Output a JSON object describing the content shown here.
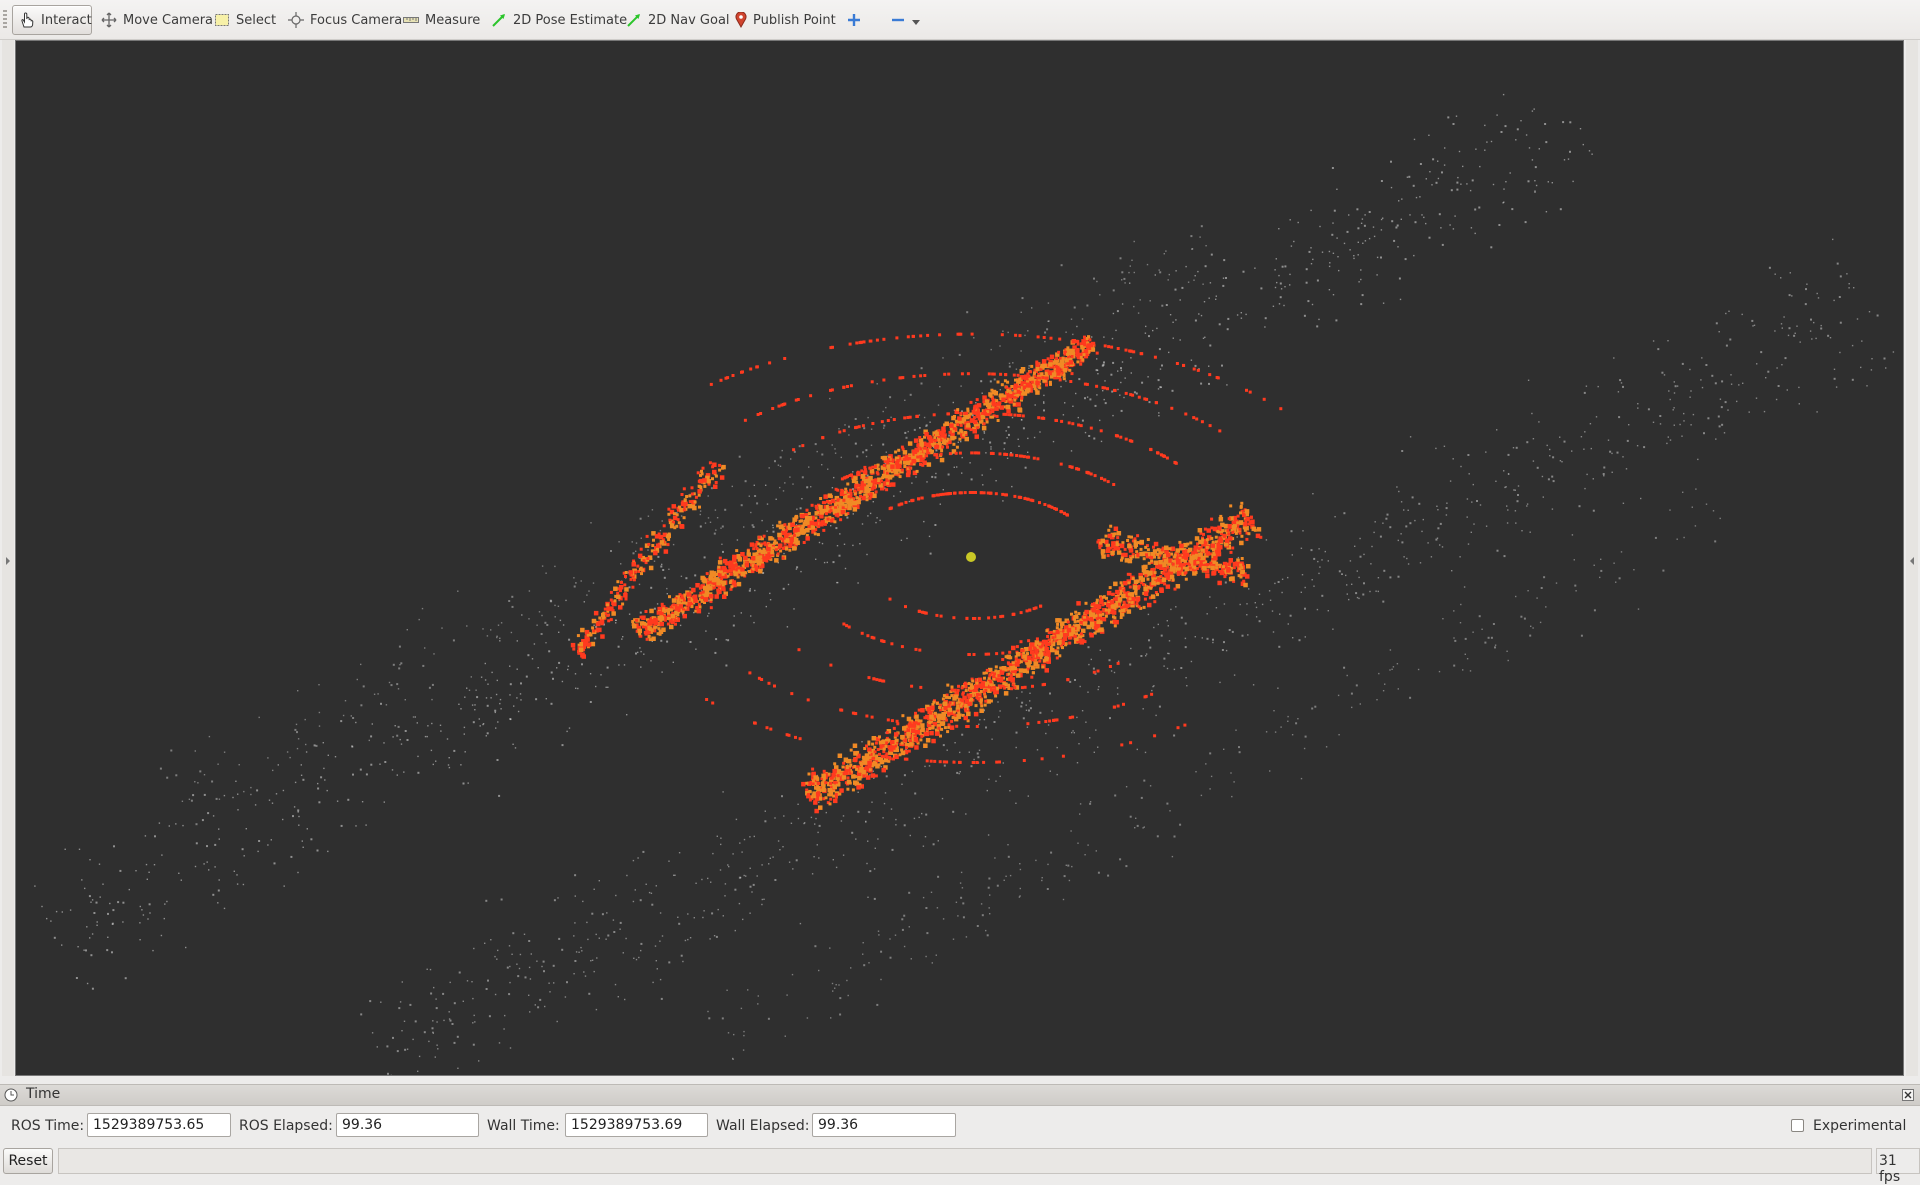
{
  "toolbar": {
    "tools": [
      {
        "label": "Interact",
        "icon": "hand-icon"
      },
      {
        "label": "Move Camera",
        "icon": "move-camera-icon"
      },
      {
        "label": "Select",
        "icon": "select-icon"
      },
      {
        "label": "Focus Camera",
        "icon": "focus-camera-icon"
      },
      {
        "label": "Measure",
        "icon": "ruler-icon"
      },
      {
        "label": "2D Pose Estimate",
        "icon": "green-arrow-icon"
      },
      {
        "label": "2D Nav Goal",
        "icon": "green-arrow-icon"
      },
      {
        "label": "Publish Point",
        "icon": "map-pin-icon"
      }
    ],
    "active_tool": "Interact"
  },
  "viewport": {
    "background": "#2f2f2f",
    "point_colors": [
      "#ff3a1f",
      "#f08a25",
      "#e0e0e0"
    ]
  },
  "time_panel": {
    "title": "Time",
    "ros_time_label": "ROS Time:",
    "ros_time": "1529389753.65",
    "ros_elapsed_label": "ROS Elapsed:",
    "ros_elapsed": "99.36",
    "wall_time_label": "Wall Time:",
    "wall_time": "1529389753.69",
    "wall_elapsed_label": "Wall Elapsed:",
    "wall_elapsed": "99.36",
    "experimental_label": "Experimental",
    "experimental_checked": false
  },
  "status": {
    "reset_label": "Reset",
    "fps": "31 fps"
  }
}
